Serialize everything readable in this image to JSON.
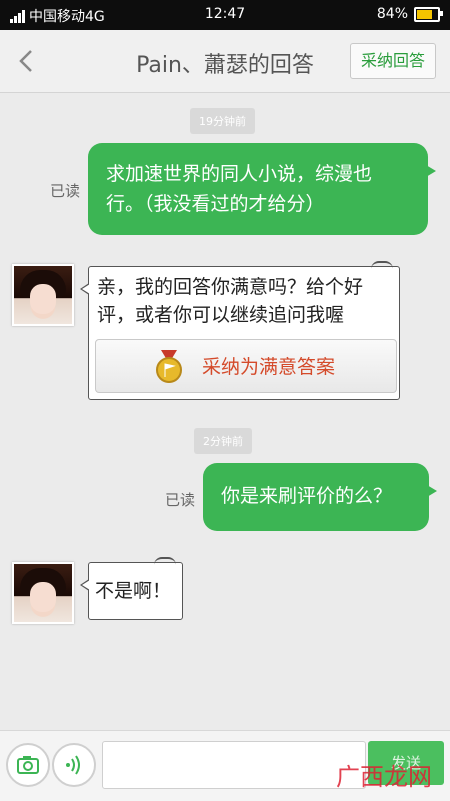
{
  "status": {
    "carrier": "中国移动4G",
    "time": "12:47",
    "battery": "84%",
    "battery_level": 0.84
  },
  "header": {
    "title": "Pain、蕭瑟的回答",
    "accept_label": "采纳回答"
  },
  "messages": {
    "time1": "19分钟前",
    "read1": "已读",
    "me1": "求加速世界的同人小说，综漫也行。（我没看过的才给分）",
    "them1": "亲，我的回答你满意吗？给个好评，或者你可以继续追问我喔",
    "award_label": "采纳为满意答案",
    "time2": "2分钟前",
    "read2": "已读",
    "me2": "你是来刷评价的么？",
    "them2": "不是啊！"
  },
  "input": {
    "placeholder": "",
    "send_label": "发送"
  },
  "watermark": "广西龙网",
  "colors": {
    "accent": "#3cb554",
    "award_text": "#d44a2a"
  }
}
